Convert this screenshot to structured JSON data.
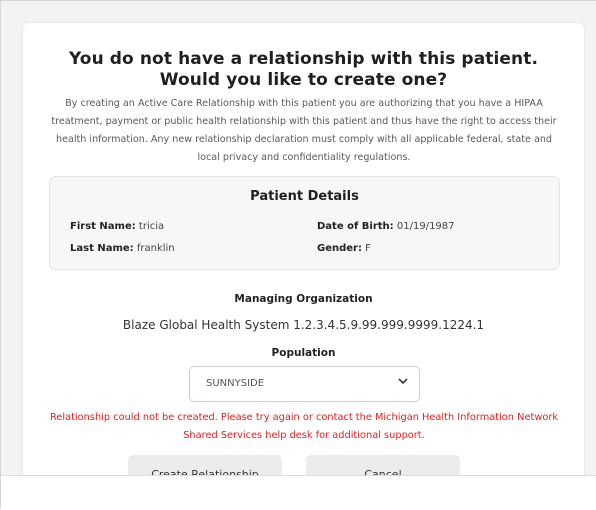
{
  "dialog": {
    "title_line1": "You do not have a relationship with this patient.",
    "title_line2": "Would you like to create one?",
    "description": "By creating an Active Care Relationship with this patient you are authorizing that you have a HIPAA treatment, payment or public health relationship with this patient and thus have the right to access their health information. Any new relationship declaration must comply with all applicable federal, state and local privacy and confidentiality regulations."
  },
  "patient_details": {
    "title": "Patient Details",
    "first_name_label": "First Name:",
    "first_name": "tricia",
    "last_name_label": "Last Name:",
    "last_name": "franklin",
    "dob_label": "Date of Birth:",
    "dob": "01/19/1987",
    "gender_label": "Gender:",
    "gender": "F"
  },
  "managing_org": {
    "label": "Managing Organization",
    "value": "Blaze Global Health System 1.2.3.4.5.9.99.999.9999.1224.1"
  },
  "population": {
    "label": "Population",
    "selected": "SUNNYSIDE",
    "icon": "chevron-down-icon"
  },
  "error_message": "Relationship could not be created. Please try again or contact the Michigan Health Information Network Shared Services help desk for additional support.",
  "buttons": {
    "create": "Create Relationship",
    "cancel": "Cancel"
  },
  "colors": {
    "error": "#e02020",
    "button_bg": "#ececec",
    "panel_bg": "#f7f7f7"
  }
}
